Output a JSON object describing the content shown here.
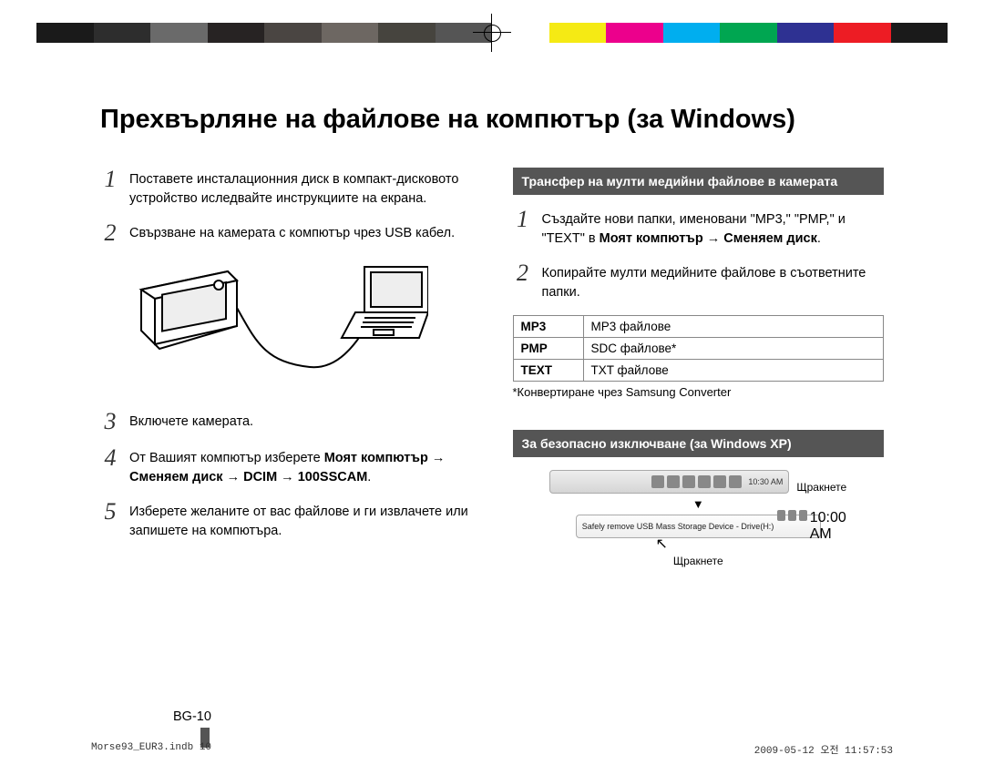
{
  "title": "Прехвърляне на файлове на компютър (за Windows)",
  "left": {
    "s1": "Поставете инсталационния диск в компакт-дисковото устройство иследвайте инструкциите на екрана.",
    "s2": "Свързване на камерата с компютър чрез USB кабел.",
    "s3": "Включете камерата.",
    "s4_a": "От Вашият компютър изберете ",
    "s4_b": "Моят компютър → Сменяем диск → DCIM → 100SSCAM",
    "s4_c": ".",
    "s5": "Изберете желаните от вас файлове и ги извлачете или запишете на компютъра."
  },
  "right": {
    "head1": "Трансфер на мулти медийни файлове в камерата",
    "s1_a": "Създайте нови папки, именовани \"MP3,\" \"PMP,\" и \"TEXT\" в ",
    "s1_b": "Моят компютър → Сменяем диск",
    "s1_c": ".",
    "s2": "Копирайте мулти медийните файлове в съответните папки.",
    "table": [
      {
        "k": "MP3",
        "v": "MP3 файлове"
      },
      {
        "k": "PMP",
        "v": "SDC файлове*"
      },
      {
        "k": "TEXT",
        "v": "TXT файлове"
      }
    ],
    "footnote": "*Конвертиране чрез Samsung Converter",
    "head2": "За безопасно изключване (за Windows XP)",
    "balloon_text": "Safely remove USB Mass Storage Device - Drive(H:)",
    "tray_clock1": "10:30 AM",
    "tray_clock2": "10:00 AM",
    "click": "Щракнете"
  },
  "pagefoot": "BG-10",
  "printfoot_left": "Morse93_EUR3.indb   10",
  "printfoot_right": "2009-05-12   오전 11:57:53",
  "colorbar": [
    "#1a1a1a",
    "#2d2d2d",
    "#6a6a6a",
    "#272323",
    "#4a4542",
    "#6d6762",
    "#46443e",
    "#555",
    "#fff",
    "#f5ea14",
    "#ec008c",
    "#00aeef",
    "#00a651",
    "#2e3192",
    "#ed1c24",
    "#1a1a1a"
  ]
}
